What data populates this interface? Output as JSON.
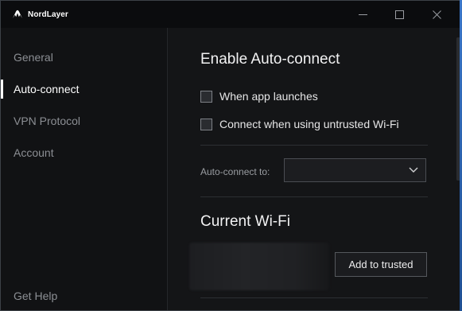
{
  "app": {
    "name": "NordLayer"
  },
  "window_controls": {
    "minimize_icon": "minimize-icon",
    "maximize_icon": "maximize-icon",
    "close_icon": "close-icon"
  },
  "sidebar": {
    "items": [
      {
        "label": "General",
        "active": false
      },
      {
        "label": "Auto-connect",
        "active": true
      },
      {
        "label": "VPN Protocol",
        "active": false
      },
      {
        "label": "Account",
        "active": false
      }
    ],
    "help_label": "Get Help"
  },
  "auto_connect": {
    "heading": "Enable Auto-connect",
    "options": [
      {
        "label": "When app launches",
        "checked": false
      },
      {
        "label": "Connect when using untrusted Wi-Fi",
        "checked": false
      }
    ],
    "target_label": "Auto-connect to:",
    "target_value": ""
  },
  "current_wifi": {
    "heading": "Current Wi-Fi",
    "network_name": "",
    "add_button_label": "Add to trusted"
  },
  "colors": {
    "background": "#111214",
    "content_background": "#141517",
    "accent_border": "#3a76c8"
  }
}
